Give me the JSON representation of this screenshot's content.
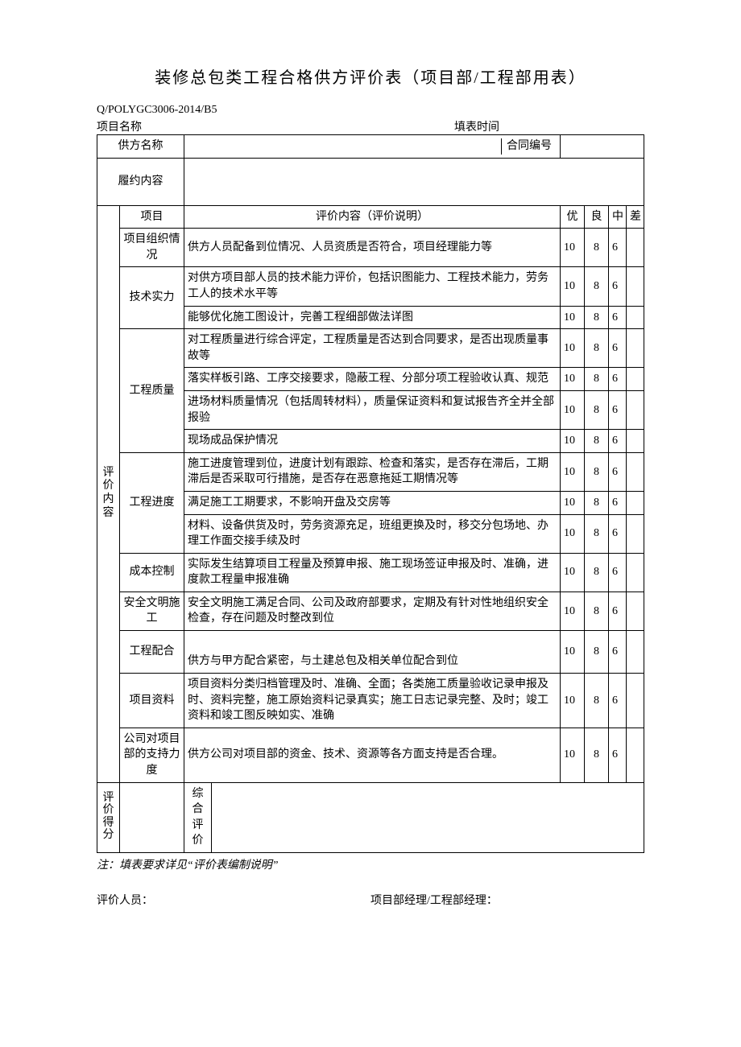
{
  "title": "装修总包类工程合格供方评价表（项目部/工程部用表）",
  "doc_code": "Q/POLYGC3006-2014/B5",
  "meta": {
    "project_name_label": "项目名称",
    "fill_time_label": "填表时间"
  },
  "header_row": {
    "supplier_name_label": "供方名称",
    "contract_no_label": "合同编号"
  },
  "performance_label": "履约内容",
  "columns": {
    "item": "项目",
    "content": "评价内容（评价说明）",
    "excellent": "优",
    "good": "良",
    "mid": "中",
    "poor": "差"
  },
  "side_eval_content": "评价内容",
  "rows": [
    {
      "item": "项目组织情况",
      "content": "供方人员配备到位情况、人员资质是否符合，项目经理能力等",
      "a": "10",
      "b": "8",
      "c": "6",
      "d": ""
    },
    {
      "item": "技术实力",
      "content": "对供方项目部人员的技术能力评价，包括识图能力、工程技术能力，劳务工人的技术水平等",
      "a": "10",
      "b": "8",
      "c": "6",
      "d": ""
    },
    {
      "item": "",
      "content": "能够优化施工图设计，完善工程细部做法详图",
      "a": "10",
      "b": "8",
      "c": "6",
      "d": ""
    },
    {
      "item": "工程质量",
      "content": "对工程质量进行综合评定，工程质量是否达到合同要求，是否出现质量事故等",
      "a": "10",
      "b": "8",
      "c": "6",
      "d": ""
    },
    {
      "item": "",
      "content": "落实样板引路、工序交接要求，隐蔽工程、分部分项工程验收认真、规范",
      "a": "10",
      "b": "8",
      "c": "6",
      "d": ""
    },
    {
      "item": "",
      "content": "进场材料质量情况（包括周转材料），质量保证资料和复试报告齐全并全部报验",
      "a": "10",
      "b": "8",
      "c": "6",
      "d": ""
    },
    {
      "item": "",
      "content": "现场成品保护情况",
      "a": "10",
      "b": "8",
      "c": "6",
      "d": ""
    },
    {
      "item": "工程进度",
      "content": "施工进度管理到位，进度计划有跟踪、检查和落实，是否存在滞后，工期滞后是否采取可行措施，是否存在恶意拖延工期情况等",
      "a": "10",
      "b": "8",
      "c": "6",
      "d": ""
    },
    {
      "item": "",
      "content": "满足施工工期要求，不影响开盘及交房等",
      "a": "10",
      "b": "8",
      "c": "6",
      "d": ""
    },
    {
      "item": "",
      "content": "材料、设备供货及时，劳务资源充足，班组更换及时，移交分包场地、办理工作面交接手续及时",
      "a": "10",
      "b": "8",
      "c": "6",
      "d": ""
    },
    {
      "item": "成本控制",
      "content": "实际发生结算项目工程量及预算申报、施工现场签证申报及时、准确，进度款工程量申报准确",
      "a": "10",
      "b": "8",
      "c": "6",
      "d": ""
    },
    {
      "item": "安全文明施工",
      "content": "安全文明施工满足合同、公司及政府部要求，定期及有针对性地组织安全检查，存在问题及时整改到位",
      "a": "10",
      "b": "8",
      "c": "6",
      "d": ""
    },
    {
      "item": "工程配合",
      "content": "供方与甲方配合紧密，与土建总包及相关单位配合到位",
      "a": "10",
      "b": "8",
      "c": "6",
      "d": ""
    },
    {
      "item": "项目资料",
      "content": "项目资料分类归档管理及时、准确、全面；各类施工质量验收记录申报及时、资料完整，施工原始资料记录真实；施工日志记录完整、及时；竣工资料和竣工图反映如实、准确",
      "a": "10",
      "b": "8",
      "c": "6",
      "d": ""
    },
    {
      "item": "公司对项目部的支持力度",
      "content": "供方公司对项目部的资金、技术、资源等各方面支持是否合理。",
      "a": "10",
      "b": "8",
      "c": "6",
      "d": ""
    }
  ],
  "score_side": "评价得分",
  "comprehensive_label": "综合评价",
  "footnote": "注：填表要求详见“评价表编制说明”",
  "signatures": {
    "evaluator": "评价人员：",
    "manager": "项目部经理/工程部经理："
  }
}
